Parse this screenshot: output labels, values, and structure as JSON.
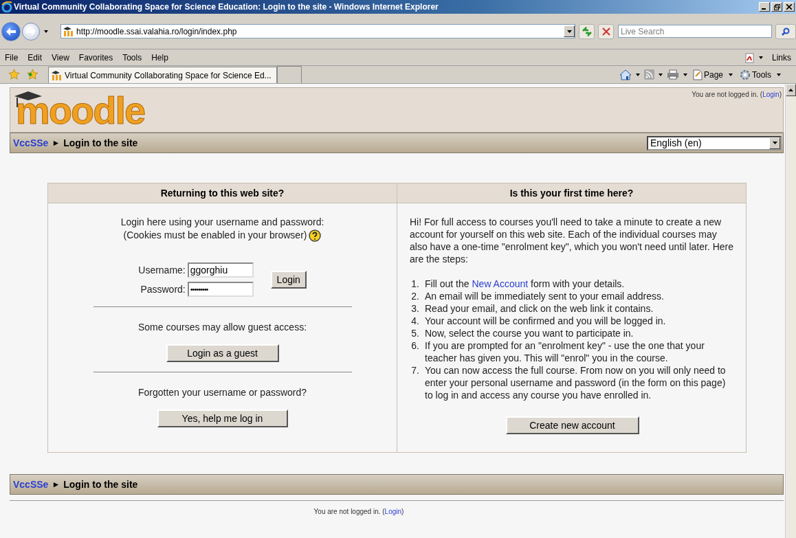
{
  "window": {
    "title": "Virtual Community Collaborating Space for Science Education: Login to the site - Windows Internet Explorer"
  },
  "address_bar": {
    "url": "http://moodle.ssai.valahia.ro/login/index.php",
    "search_placeholder": "Live Search"
  },
  "menu": [
    "File",
    "Edit",
    "View",
    "Favorites",
    "Tools",
    "Help"
  ],
  "links_label": "Links",
  "tab": {
    "title": "Virtual Community Collaborating Space for Science Ed...",
    "selected": true
  },
  "command_bar": {
    "page": "Page",
    "tools": "Tools"
  },
  "header": {
    "logo": "moodle",
    "login_info": {
      "text": "You are not logged in. (",
      "link": "Login",
      "end": ")"
    }
  },
  "breadcrumb": {
    "home": "VccSSe",
    "separator": "►",
    "current": "Login to the site"
  },
  "language": "English (en)",
  "returning": {
    "title": "Returning to this web site?",
    "intro": [
      "Login here using your username and password:",
      "(Cookies must be enabled in your browser)"
    ],
    "username_label": "Username:",
    "username": "ggorghiu",
    "password_label": "Password:",
    "password": "•••••••••",
    "login_button": "Login",
    "guest_text": "Some courses may allow guest access:",
    "guest_button": "Login as a guest",
    "forgot_text": "Forgotten your username or password?",
    "forgot_button": "Yes, help me log in"
  },
  "first_time": {
    "title": "Is this your first time here?",
    "intro": "Hi! For full access to courses you'll need to take a minute to create a new account for yourself on this web site. Each of the individual courses may also have a one-time \"enrolment key\", which you won't need until later. Here are the steps:",
    "steps": [
      {
        "number": "1.",
        "text": "Fill out the ",
        "link": "New Account",
        "after": " form with your details."
      },
      {
        "number": "2.",
        "text": "An email will be immediately sent to your email address."
      },
      {
        "number": "3.",
        "text": "Read your email, and click on the web link it contains."
      },
      {
        "number": "4.",
        "text": "Your account will be confirmed and you will be logged in."
      },
      {
        "number": "5.",
        "text": "Now, select the course you want to participate in."
      },
      {
        "number": "6.",
        "text": "If you are prompted for an \"enrolment key\" - use the one that your teacher has given you. This will \"enrol\" you in the course."
      },
      {
        "number": "7.",
        "text": "You can now access the full course. From now on you will only need to enter your personal username and password (in the form on this page) to log in and access any course you have enrolled in."
      }
    ],
    "create_button": "Create new account"
  },
  "footer_breadcrumb": {
    "home": "VccSSe",
    "separator": "►",
    "current": "Login to the site"
  },
  "footer": {
    "text": "You are not logged in. (",
    "link": "Login",
    "end": ")"
  }
}
